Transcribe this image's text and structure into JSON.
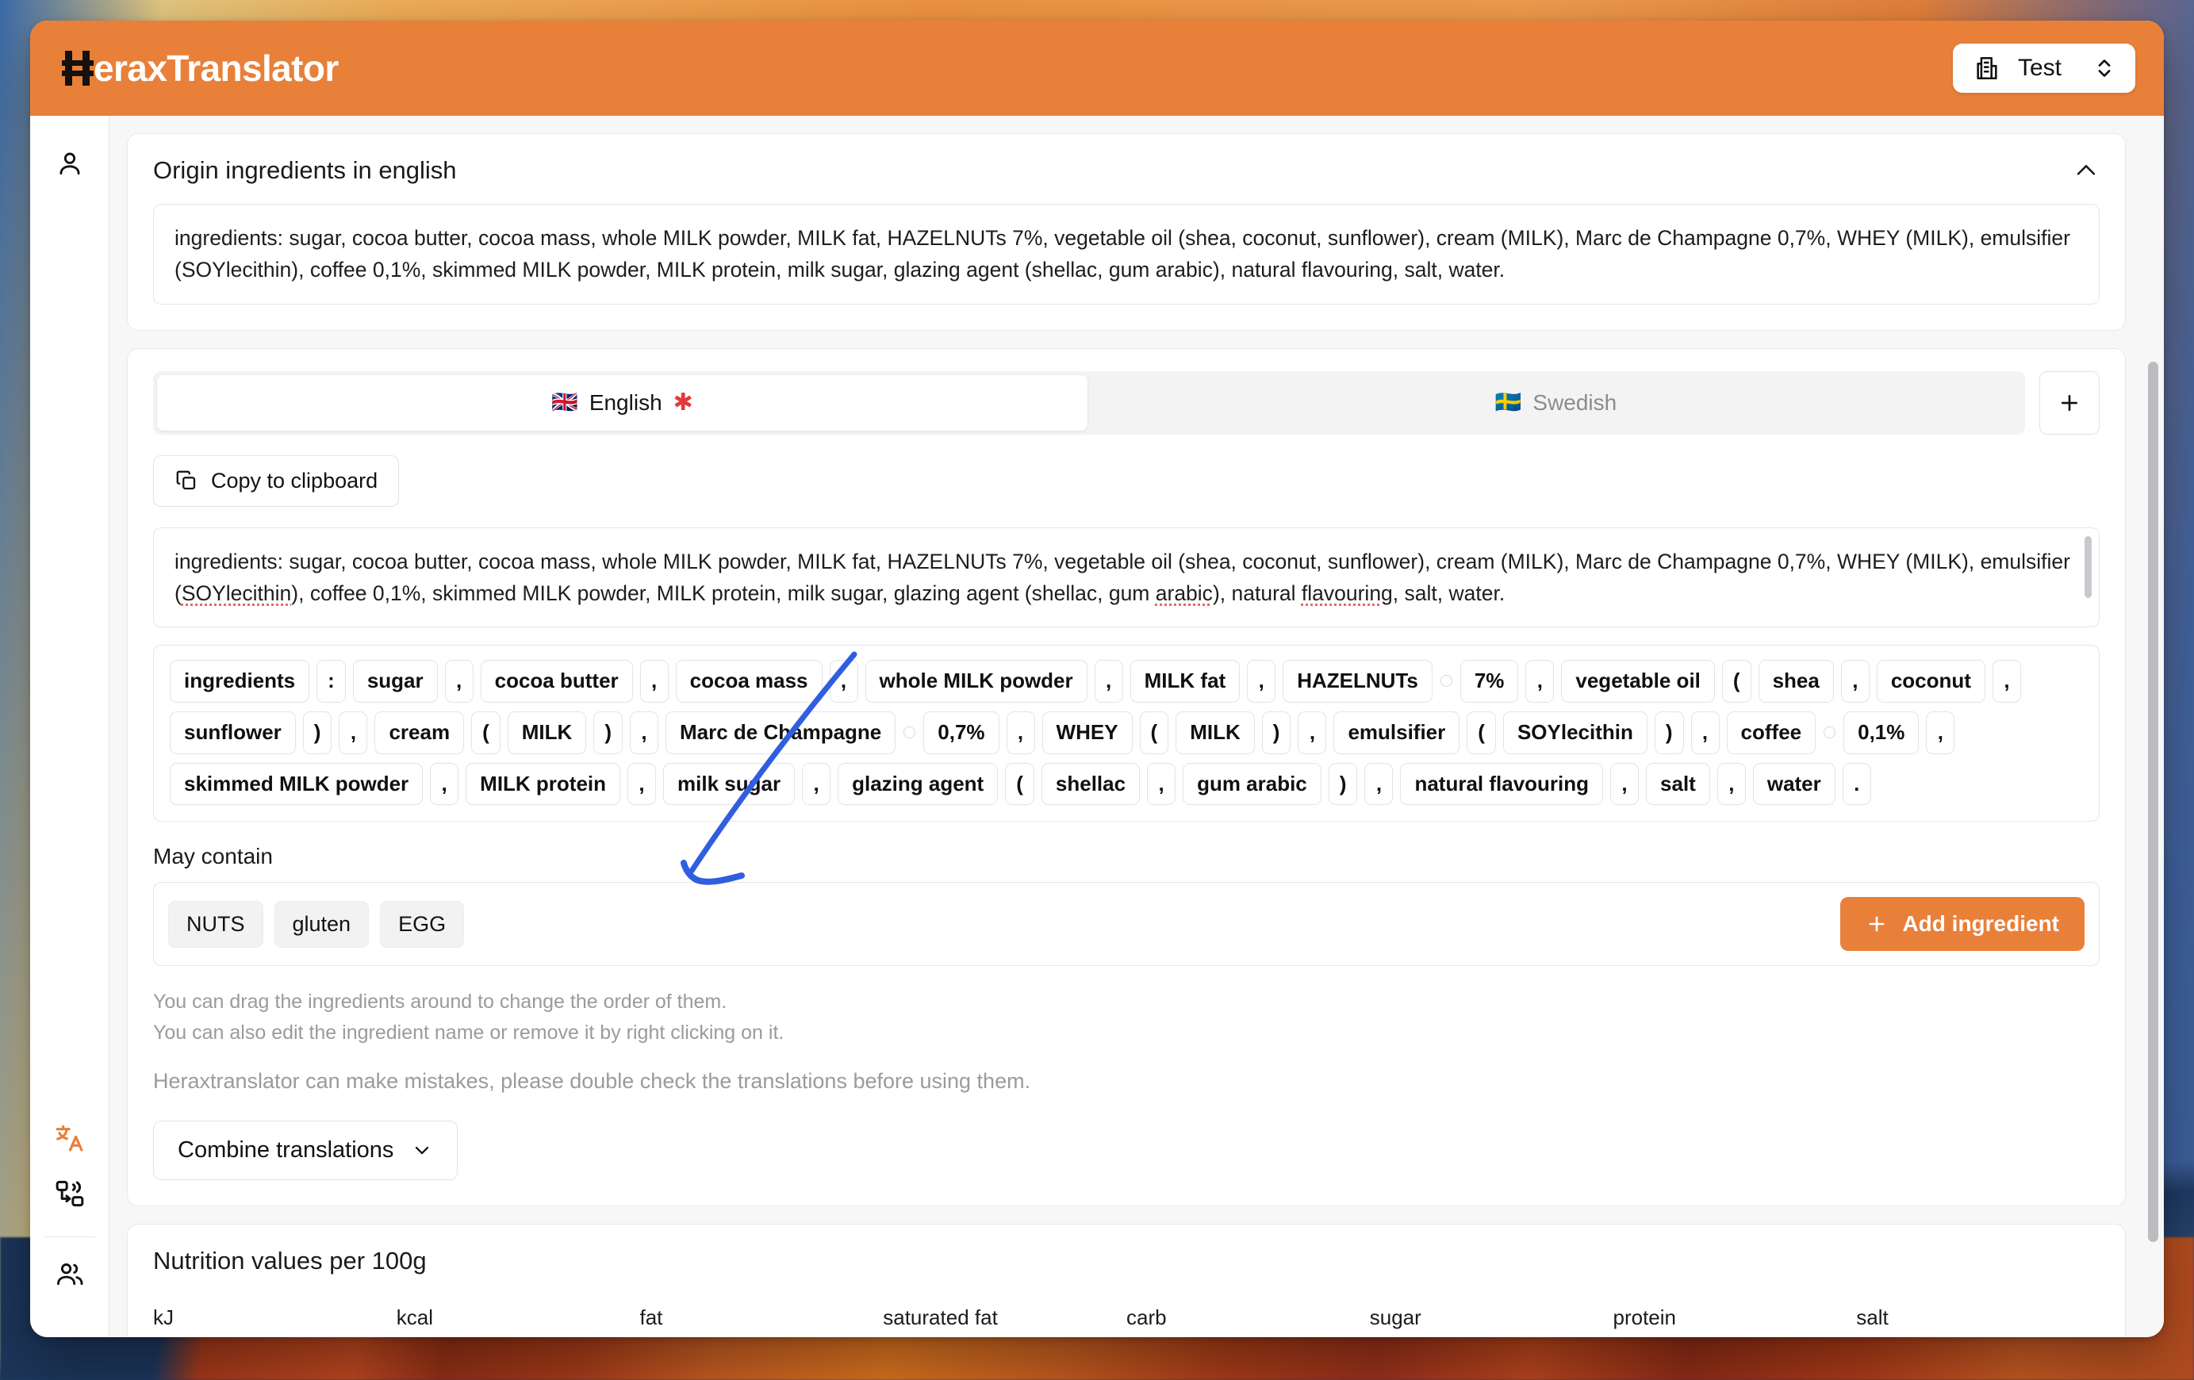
{
  "app": {
    "logo_h": "H",
    "logo_rest": "eraxTranslator",
    "org_name": "Test",
    "org_icon": "building-icon",
    "chevron_icon": "chevron-up-down-icon"
  },
  "sidebar": {
    "items": [
      {
        "name": "profile",
        "icon": "user-icon"
      },
      {
        "name": "translate",
        "icon": "translate-icon"
      },
      {
        "name": "convert",
        "icon": "convert-icon"
      },
      {
        "name": "team",
        "icon": "users-icon"
      }
    ]
  },
  "origin_card": {
    "title": "Origin ingredients in english",
    "collapse_icon": "chevron-up-icon",
    "text": "ingredients: sugar, cocoa butter, cocoa mass, whole MILK powder, MILK fat, HAZELNUTs 7%, vegetable oil (shea, coconut, sunflower), cream (MILK), Marc de Champagne 0,7%, WHEY (MILK), emulsifier (SOYlecithin), coffee 0,1%, skimmed MILK powder, MILK protein, milk sugar, glazing agent (shellac, gum arabic), natural flavouring, salt, water."
  },
  "translation_card": {
    "tabs": [
      {
        "label": "English",
        "flag": "🇬🇧",
        "required_marker": "✱",
        "active": true
      },
      {
        "label": "Swedish",
        "flag": "🇸🇪",
        "required_marker": "",
        "active": false
      }
    ],
    "add_language_label": "+",
    "copy_button": "Copy to clipboard",
    "copy_icon": "copy-icon",
    "translation_text_parts": [
      {
        "t": "ingredients: sugar, cocoa butter, cocoa mass, whole MILK powder, MILK fat, HAZELNUTs 7%, vegetable oil (shea, coconut, sunflower), cream (MILK), Marc de Champagne 0,7%, WHEY (MILK), emulsifier (",
        "misspelled": false
      },
      {
        "t": "SOYlecithin",
        "misspelled": true
      },
      {
        "t": "), coffee 0,1%, skimmed MILK powder, MILK protein, milk sugar, glazing agent (shellac, gum ",
        "misspelled": false
      },
      {
        "t": "arabic",
        "misspelled": true
      },
      {
        "t": "), natural ",
        "misspelled": false
      },
      {
        "t": "flavouring",
        "misspelled": true
      },
      {
        "t": ", salt, water.",
        "misspelled": false
      }
    ],
    "chips": [
      {
        "text": "ingredients",
        "kind": "word"
      },
      {
        "text": ":",
        "kind": "punct"
      },
      {
        "text": "sugar",
        "kind": "word"
      },
      {
        "text": ",",
        "kind": "punct"
      },
      {
        "text": "cocoa butter",
        "kind": "word"
      },
      {
        "text": ",",
        "kind": "punct"
      },
      {
        "text": "cocoa mass",
        "kind": "word"
      },
      {
        "text": ",",
        "kind": "punct"
      },
      {
        "text": "whole MILK powder",
        "kind": "word"
      },
      {
        "text": ",",
        "kind": "punct"
      },
      {
        "text": "MILK fat",
        "kind": "word"
      },
      {
        "text": ",",
        "kind": "punct"
      },
      {
        "text": "HAZELNUTs",
        "kind": "word"
      },
      {
        "text": "",
        "kind": "space"
      },
      {
        "text": "7%",
        "kind": "word"
      },
      {
        "text": ",",
        "kind": "punct"
      },
      {
        "text": "vegetable oil",
        "kind": "word"
      },
      {
        "text": "(",
        "kind": "punct"
      },
      {
        "text": "shea",
        "kind": "word"
      },
      {
        "text": ",",
        "kind": "punct"
      },
      {
        "text": "coconut",
        "kind": "word"
      },
      {
        "text": ",",
        "kind": "punct"
      },
      {
        "text": "sunflower",
        "kind": "word"
      },
      {
        "text": ")",
        "kind": "punct"
      },
      {
        "text": ",",
        "kind": "punct"
      },
      {
        "text": "cream",
        "kind": "word"
      },
      {
        "text": "(",
        "kind": "punct"
      },
      {
        "text": "MILK",
        "kind": "word"
      },
      {
        "text": ")",
        "kind": "punct"
      },
      {
        "text": ",",
        "kind": "punct"
      },
      {
        "text": "Marc de Champagne",
        "kind": "word"
      },
      {
        "text": "",
        "kind": "space"
      },
      {
        "text": "0,7%",
        "kind": "word"
      },
      {
        "text": ",",
        "kind": "punct"
      },
      {
        "text": "WHEY",
        "kind": "word"
      },
      {
        "text": "(",
        "kind": "punct"
      },
      {
        "text": "MILK",
        "kind": "word"
      },
      {
        "text": ")",
        "kind": "punct"
      },
      {
        "text": ",",
        "kind": "punct"
      },
      {
        "text": "emulsifier",
        "kind": "word"
      },
      {
        "text": "(",
        "kind": "punct"
      },
      {
        "text": "SOYlecithin",
        "kind": "word"
      },
      {
        "text": ")",
        "kind": "punct"
      },
      {
        "text": ",",
        "kind": "punct"
      },
      {
        "text": "coffee",
        "kind": "word"
      },
      {
        "text": "",
        "kind": "space"
      },
      {
        "text": "0,1%",
        "kind": "word"
      },
      {
        "text": ",",
        "kind": "punct"
      },
      {
        "text": "skimmed MILK powder",
        "kind": "word"
      },
      {
        "text": ",",
        "kind": "punct"
      },
      {
        "text": "MILK protein",
        "kind": "word"
      },
      {
        "text": ",",
        "kind": "punct"
      },
      {
        "text": "milk sugar",
        "kind": "word"
      },
      {
        "text": ",",
        "kind": "punct"
      },
      {
        "text": "glazing agent",
        "kind": "word"
      },
      {
        "text": "(",
        "kind": "punct"
      },
      {
        "text": "shellac",
        "kind": "word"
      },
      {
        "text": ",",
        "kind": "punct"
      },
      {
        "text": "gum arabic",
        "kind": "word"
      },
      {
        "text": ")",
        "kind": "punct"
      },
      {
        "text": ",",
        "kind": "punct"
      },
      {
        "text": "natural flavouring",
        "kind": "word"
      },
      {
        "text": ",",
        "kind": "punct"
      },
      {
        "text": "salt",
        "kind": "word"
      },
      {
        "text": ",",
        "kind": "punct"
      },
      {
        "text": "water",
        "kind": "word"
      },
      {
        "text": ".",
        "kind": "punct"
      }
    ],
    "may_contain_label": "May contain",
    "may_contain": [
      "NUTS",
      "gluten",
      "EGG"
    ],
    "add_ingredient_label": "Add ingredient",
    "add_ingredient_icon": "plus-icon",
    "hint_line_1": "You can drag the ingredients around to change the order of them.",
    "hint_line_2": "You can also edit the ingredient name or remove it by right clicking on it.",
    "disclaimer": "Heraxtranslator can make mistakes, please double check the translations before using them.",
    "combine_label": "Combine translations",
    "combine_icon": "chevron-down-icon"
  },
  "nutrition_card": {
    "title": "Nutrition values per 100g",
    "columns": [
      "kJ",
      "kcal",
      "fat",
      "saturated fat",
      "carb",
      "sugar",
      "protein",
      "salt"
    ]
  },
  "colors": {
    "brand_orange": "#e8803a",
    "required_red": "#e03a3a",
    "annotation_blue": "#2f5fe0"
  }
}
